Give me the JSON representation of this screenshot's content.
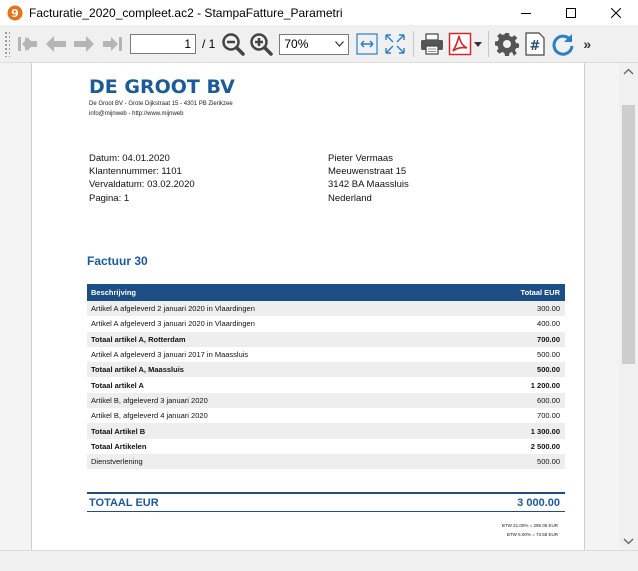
{
  "window": {
    "title": "Facturatie_2020_compleet.ac2 - StampaFatture_Parametri"
  },
  "toolbar": {
    "page_value": "1",
    "page_total": "/ 1",
    "zoom": "70%",
    "more": "»",
    "icons": [
      "first-page-icon",
      "previous-page-icon",
      "next-page-icon",
      "last-page-icon",
      "zoom-out-icon",
      "zoom-in-icon",
      "fit-width-icon",
      "fit-page-icon",
      "print-icon",
      "pdf-export-icon",
      "settings-icon",
      "page-number-icon",
      "refresh-icon"
    ]
  },
  "document": {
    "company": "DE GROOT BV",
    "address_line": "De Groot BV - Grote Dijkstraat 15 - 4301 PB Zierikzee",
    "contact_line": "info@mijnweb - http://www.mijnweb",
    "meta_left": [
      "Datum: 04.01.2020",
      "Klantennummer: 1101",
      "Vervaldatum: 03.02.2020",
      "Pagina: 1"
    ],
    "meta_right": [
      "Pieter  Vermaas",
      "Meeuwenstraat 15",
      "3142 BA Maassluis",
      "Nederland"
    ],
    "invoice_title": "Factuur 30",
    "table": {
      "headers": [
        "Beschrijving",
        "Totaal EUR"
      ],
      "rows": [
        {
          "desc": "Artikel A afgeleverd 2 januari 2020 in Vlaardingen",
          "amount": "300.00",
          "bold": false
        },
        {
          "desc": "Artikel A afgeleverd 3 januari 2020 in Vlaardingen",
          "amount": "400.00",
          "bold": false
        },
        {
          "desc": "Totaal artikel A, Rotterdam",
          "amount": "700.00",
          "bold": true
        },
        {
          "desc": "Artikel A afgeleverd 3 januari 2017 in Maassluis",
          "amount": "500.00",
          "bold": false
        },
        {
          "desc": "Totaal artikel A, Maassluis",
          "amount": "500.00",
          "bold": true
        },
        {
          "desc": "Totaal artikel A",
          "amount": "1 200.00",
          "bold": true
        },
        {
          "desc": "Artikel B, afgeleverd 3 januari 2020",
          "amount": "600.00",
          "bold": false
        },
        {
          "desc": "Artikel B, afgeleverd 4 januari 2020",
          "amount": "700.00",
          "bold": false
        },
        {
          "desc": "Totaal Artikel B",
          "amount": "1 300.00",
          "bold": true
        },
        {
          "desc": "Totaal Artikelen",
          "amount": "2 500.00",
          "bold": true
        },
        {
          "desc": "Dienstverlening",
          "amount": "500.00",
          "bold": false
        }
      ]
    },
    "total_label": "TOTAAL EUR",
    "total_value": "3 000.00",
    "vat_lines": [
      "BTW  21.00% = 295.05 EUR",
      "BTW  6.00% = 73.58 EUR"
    ]
  },
  "colors": {
    "brand_blue": "#1d5a9c",
    "header_blue": "#1c4d84",
    "pdf_red": "#d9252a",
    "refresh_blue": "#2a7fc9"
  }
}
